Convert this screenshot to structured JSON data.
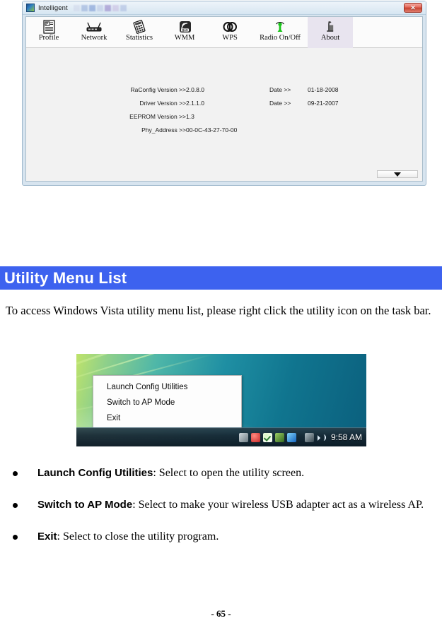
{
  "dialog": {
    "title": "Intelligent",
    "close_label": "✕",
    "title_block_colors": [
      "#cfd6ea",
      "#8fa8d8",
      "#6f8fd0",
      "#b9c6e4",
      "#8e79c4",
      "#c6b9e0",
      "#a7b8df"
    ],
    "toolbar": [
      {
        "label": "Profile",
        "icon": "profile-icon",
        "selected": false
      },
      {
        "label": "Network",
        "icon": "network-icon",
        "selected": false
      },
      {
        "label": "Statistics",
        "icon": "statistics-icon",
        "selected": false
      },
      {
        "label": "WMM",
        "icon": "wmm-qos-icon",
        "selected": false
      },
      {
        "label": "WPS",
        "icon": "wps-icon",
        "selected": false
      },
      {
        "label": "Radio On/Off",
        "icon": "radio-onoff-icon",
        "selected": false
      },
      {
        "label": "About",
        "icon": "about-icon",
        "selected": true
      }
    ],
    "info": [
      {
        "label": "RaConfig Version >>",
        "value": "2.0.8.0",
        "date_label": "Date >>",
        "date_value": "01-18-2008"
      },
      {
        "label": "Driver Version >>",
        "value": "2.1.1.0",
        "date_label": "Date >>",
        "date_value": "09-21-2007"
      },
      {
        "label": "EEPROM Version >>",
        "value": "1.3",
        "date_label": "",
        "date_value": ""
      },
      {
        "label": "Phy_Address >>",
        "value": "00-0C-43-27-70-00",
        "date_label": "",
        "date_value": ""
      }
    ]
  },
  "section": {
    "heading": "Utility Menu List",
    "paragraph": "To access Windows Vista utility menu list, please right click the utility icon on the task bar."
  },
  "vista": {
    "menu_items": [
      "Launch Config Utilities",
      "Switch to AP Mode",
      "Exit"
    ],
    "clock": "9:58 AM"
  },
  "bullets": [
    {
      "term": "Launch Config Utilities",
      "desc": ": Select to open the utility screen."
    },
    {
      "term": "Switch to AP Mode",
      "desc": ": Select to make your wireless USB adapter act as a wireless AP."
    },
    {
      "term": "Exit",
      "desc": ": Select to close the utility program."
    }
  ],
  "footer": "- 65 -",
  "colors": {
    "heading_bg": "#3d62ef",
    "heading_fg": "#ffffff",
    "close_btn": "#c6412f",
    "tab_selected_bg": "#e8e4ef"
  }
}
